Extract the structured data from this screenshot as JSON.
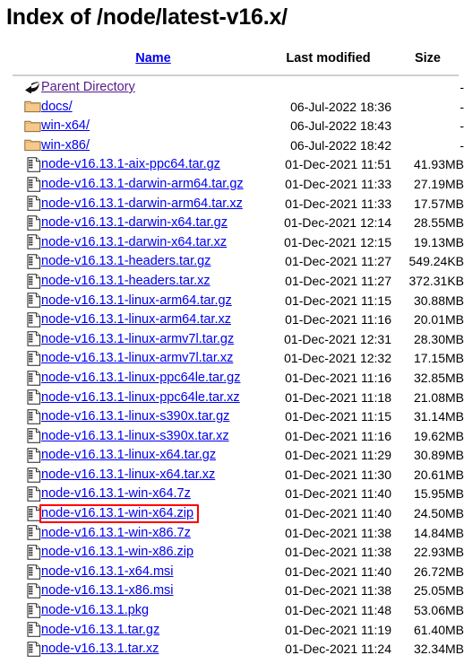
{
  "page": {
    "title": "Index of /node/latest-v16.x/"
  },
  "table": {
    "headers": {
      "name": "Name",
      "last_modified": "Last modified",
      "size": "Size"
    },
    "rows": [
      {
        "icon": "back-arrow-icon",
        "name": "Parent Directory",
        "visited": true,
        "date": "",
        "size": "-",
        "highlighted": false
      },
      {
        "icon": "folder-icon",
        "name": "docs/",
        "visited": false,
        "date": "06-Jul-2022 18:36",
        "size": "-",
        "highlighted": false
      },
      {
        "icon": "folder-icon",
        "name": "win-x64/",
        "visited": false,
        "date": "06-Jul-2022 18:43",
        "size": "-",
        "highlighted": false
      },
      {
        "icon": "folder-icon",
        "name": "win-x86/",
        "visited": false,
        "date": "06-Jul-2022 18:42",
        "size": "-",
        "highlighted": false
      },
      {
        "icon": "file-icon",
        "name": "node-v16.13.1-aix-ppc64.tar.gz",
        "visited": false,
        "date": "01-Dec-2021 11:51",
        "size": "41.93MB",
        "highlighted": false
      },
      {
        "icon": "file-icon",
        "name": "node-v16.13.1-darwin-arm64.tar.gz",
        "visited": false,
        "date": "01-Dec-2021 11:33",
        "size": "27.19MB",
        "highlighted": false
      },
      {
        "icon": "file-icon",
        "name": "node-v16.13.1-darwin-arm64.tar.xz",
        "visited": false,
        "date": "01-Dec-2021 11:33",
        "size": "17.57MB",
        "highlighted": false
      },
      {
        "icon": "file-icon",
        "name": "node-v16.13.1-darwin-x64.tar.gz",
        "visited": false,
        "date": "01-Dec-2021 12:14",
        "size": "28.55MB",
        "highlighted": false
      },
      {
        "icon": "file-icon",
        "name": "node-v16.13.1-darwin-x64.tar.xz",
        "visited": false,
        "date": "01-Dec-2021 12:15",
        "size": "19.13MB",
        "highlighted": false
      },
      {
        "icon": "file-icon",
        "name": "node-v16.13.1-headers.tar.gz",
        "visited": false,
        "date": "01-Dec-2021 11:27",
        "size": "549.24KB",
        "highlighted": false
      },
      {
        "icon": "file-icon",
        "name": "node-v16.13.1-headers.tar.xz",
        "visited": false,
        "date": "01-Dec-2021 11:27",
        "size": "372.31KB",
        "highlighted": false
      },
      {
        "icon": "file-icon",
        "name": "node-v16.13.1-linux-arm64.tar.gz",
        "visited": false,
        "date": "01-Dec-2021 11:15",
        "size": "30.88MB",
        "highlighted": false
      },
      {
        "icon": "file-icon",
        "name": "node-v16.13.1-linux-arm64.tar.xz",
        "visited": false,
        "date": "01-Dec-2021 11:16",
        "size": "20.01MB",
        "highlighted": false
      },
      {
        "icon": "file-icon",
        "name": "node-v16.13.1-linux-armv7l.tar.gz",
        "visited": false,
        "date": "01-Dec-2021 12:31",
        "size": "28.30MB",
        "highlighted": false
      },
      {
        "icon": "file-icon",
        "name": "node-v16.13.1-linux-armv7l.tar.xz",
        "visited": false,
        "date": "01-Dec-2021 12:32",
        "size": "17.15MB",
        "highlighted": false
      },
      {
        "icon": "file-icon",
        "name": "node-v16.13.1-linux-ppc64le.tar.gz",
        "visited": false,
        "date": "01-Dec-2021 11:16",
        "size": "32.85MB",
        "highlighted": false
      },
      {
        "icon": "file-icon",
        "name": "node-v16.13.1-linux-ppc64le.tar.xz",
        "visited": false,
        "date": "01-Dec-2021 11:18",
        "size": "21.08MB",
        "highlighted": false
      },
      {
        "icon": "file-icon",
        "name": "node-v16.13.1-linux-s390x.tar.gz",
        "visited": false,
        "date": "01-Dec-2021 11:15",
        "size": "31.14MB",
        "highlighted": false
      },
      {
        "icon": "file-icon",
        "name": "node-v16.13.1-linux-s390x.tar.xz",
        "visited": false,
        "date": "01-Dec-2021 11:16",
        "size": "19.62MB",
        "highlighted": false
      },
      {
        "icon": "file-icon",
        "name": "node-v16.13.1-linux-x64.tar.gz",
        "visited": false,
        "date": "01-Dec-2021 11:29",
        "size": "30.89MB",
        "highlighted": false
      },
      {
        "icon": "file-icon",
        "name": "node-v16.13.1-linux-x64.tar.xz",
        "visited": false,
        "date": "01-Dec-2021 11:30",
        "size": "20.61MB",
        "highlighted": false
      },
      {
        "icon": "file-icon",
        "name": "node-v16.13.1-win-x64.7z",
        "visited": false,
        "date": "01-Dec-2021 11:40",
        "size": "15.95MB",
        "highlighted": false
      },
      {
        "icon": "file-icon",
        "name": "node-v16.13.1-win-x64.zip",
        "visited": false,
        "date": "01-Dec-2021 11:40",
        "size": "24.50MB",
        "highlighted": true
      },
      {
        "icon": "file-icon",
        "name": "node-v16.13.1-win-x86.7z",
        "visited": false,
        "date": "01-Dec-2021 11:38",
        "size": "14.84MB",
        "highlighted": false
      },
      {
        "icon": "file-icon",
        "name": "node-v16.13.1-win-x86.zip",
        "visited": false,
        "date": "01-Dec-2021 11:38",
        "size": "22.93MB",
        "highlighted": false
      },
      {
        "icon": "file-icon",
        "name": "node-v16.13.1-x64.msi",
        "visited": false,
        "date": "01-Dec-2021 11:40",
        "size": "26.72MB",
        "highlighted": false
      },
      {
        "icon": "file-icon",
        "name": "node-v16.13.1-x86.msi",
        "visited": false,
        "date": "01-Dec-2021 11:38",
        "size": "25.05MB",
        "highlighted": false
      },
      {
        "icon": "file-icon",
        "name": "node-v16.13.1.pkg",
        "visited": false,
        "date": "01-Dec-2021 11:48",
        "size": "53.06MB",
        "highlighted": false
      },
      {
        "icon": "file-icon",
        "name": "node-v16.13.1.tar.gz",
        "visited": false,
        "date": "01-Dec-2021 11:19",
        "size": "61.40MB",
        "highlighted": false
      },
      {
        "icon": "file-icon",
        "name": "node-v16.13.1.tar.xz",
        "visited": false,
        "date": "01-Dec-2021 11:24",
        "size": "32.34MB",
        "highlighted": false
      }
    ]
  },
  "colors": {
    "link": "#0000EE",
    "visited_link": "#551A8B",
    "highlight_border": "#FF0000",
    "rule": "#cfcfcf",
    "folder": "#F6C98A"
  }
}
